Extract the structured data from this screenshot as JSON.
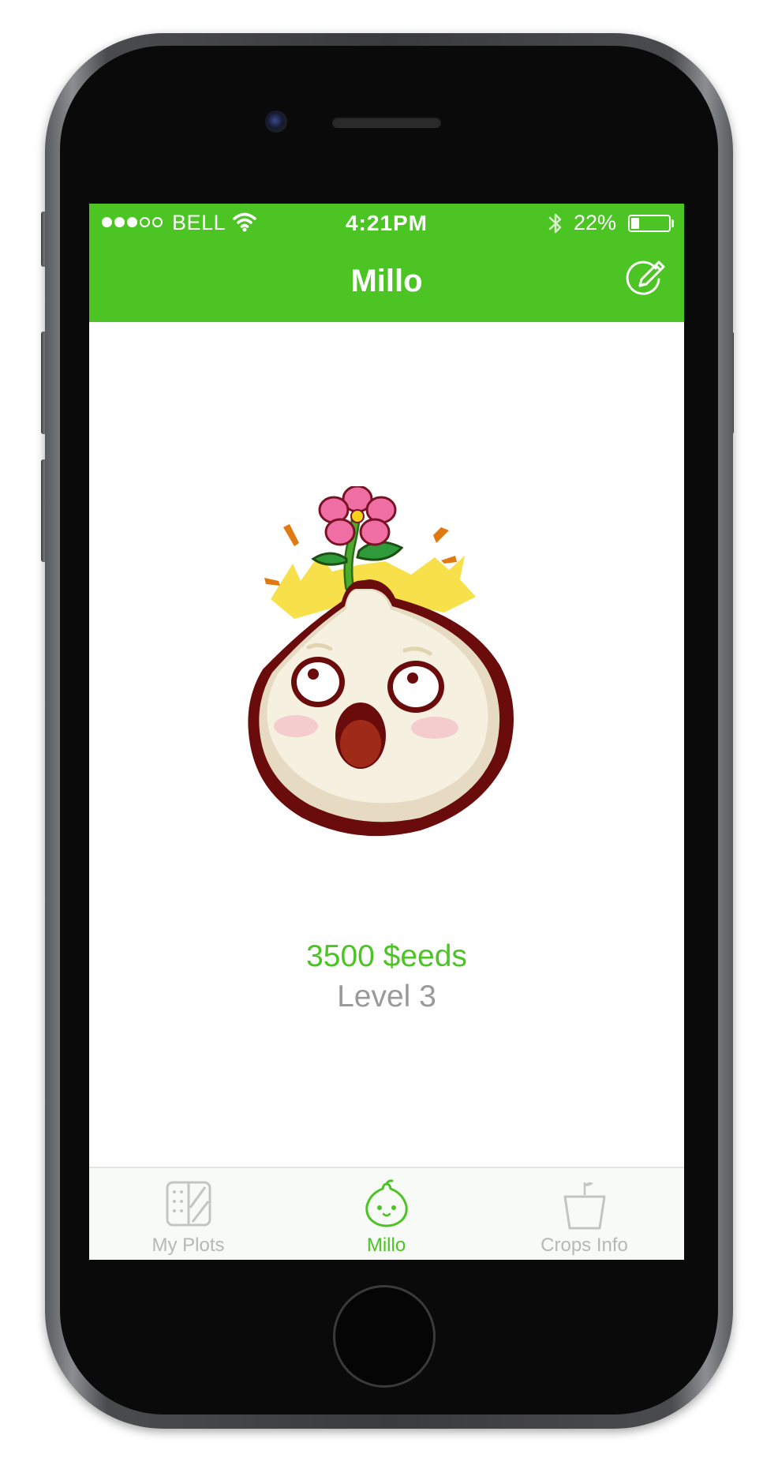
{
  "colors": {
    "accent": "#4cc423",
    "inactive": "#b7b7b7",
    "subtitle": "#9a9a9a"
  },
  "status_bar": {
    "carrier": "BELL",
    "time": "4:21PM",
    "battery": "22%",
    "battery_level": 0.22,
    "signal_bars": 3,
    "signal_max": 5
  },
  "nav": {
    "title": "Millo",
    "edit_icon": "edit-pencil-icon"
  },
  "main": {
    "mascot_icon": "surprised-bulb-with-flower",
    "seeds": "3500 $eeds",
    "level": "Level 3"
  },
  "tabs": [
    {
      "label": "My Plots",
      "icon": "plots-grid-icon",
      "active": false
    },
    {
      "label": "Millo",
      "icon": "millo-face-icon",
      "active": true
    },
    {
      "label": "Crops Info",
      "icon": "crop-pot-icon",
      "active": false
    }
  ]
}
